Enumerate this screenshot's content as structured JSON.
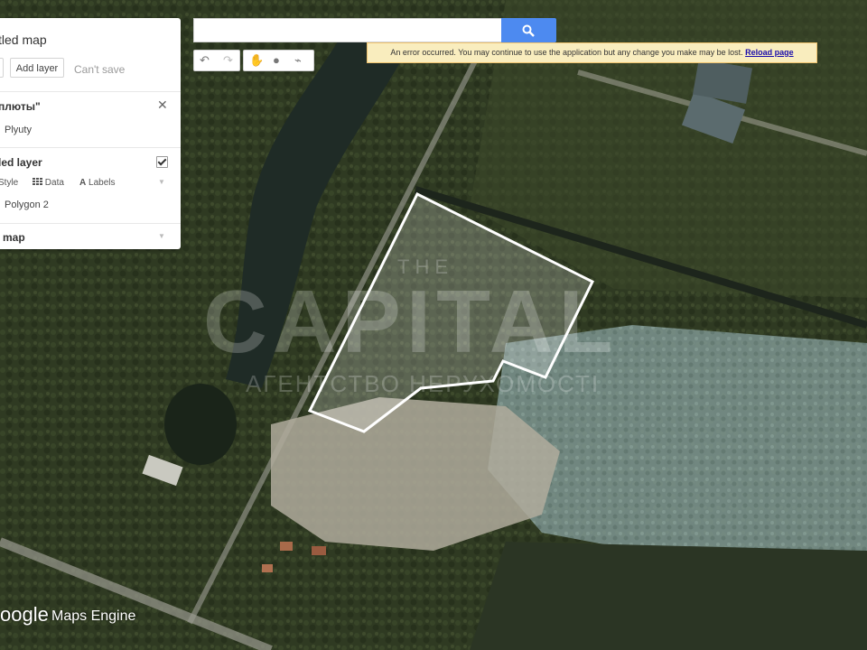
{
  "panel": {
    "title": "tled map",
    "add_layer": "Add layer",
    "cant_save": "Can't save",
    "layer1_title": "плюты\"",
    "layer1_item": "Plyuty",
    "layer2_title": "led layer",
    "style_label": "Style",
    "data_label": "Data",
    "labels_label": "Labels",
    "layer2_item": "Polygon 2",
    "base_map": "map"
  },
  "toolbar": {
    "undo": "undo-icon",
    "redo": "redo-icon",
    "hand": "hand-icon",
    "marker": "marker-icon",
    "line": "draw-line-icon"
  },
  "search": {
    "placeholder": ""
  },
  "error": {
    "message": "An error occurred. You may continue to use the application but any change you make may be lost.",
    "link": "Reload page"
  },
  "footer": {
    "brand_google": "oogle",
    "brand_product": "Maps Engine"
  },
  "watermark": {
    "line1": "THE",
    "line2": "CAPITAL",
    "line3": "АГЕНТСТВО НЕРУХОМОСТІ"
  },
  "colors": {
    "polygon_stroke": "#ffffff",
    "search_button": "#4d8af0",
    "error_bg": "#f9edbe"
  }
}
